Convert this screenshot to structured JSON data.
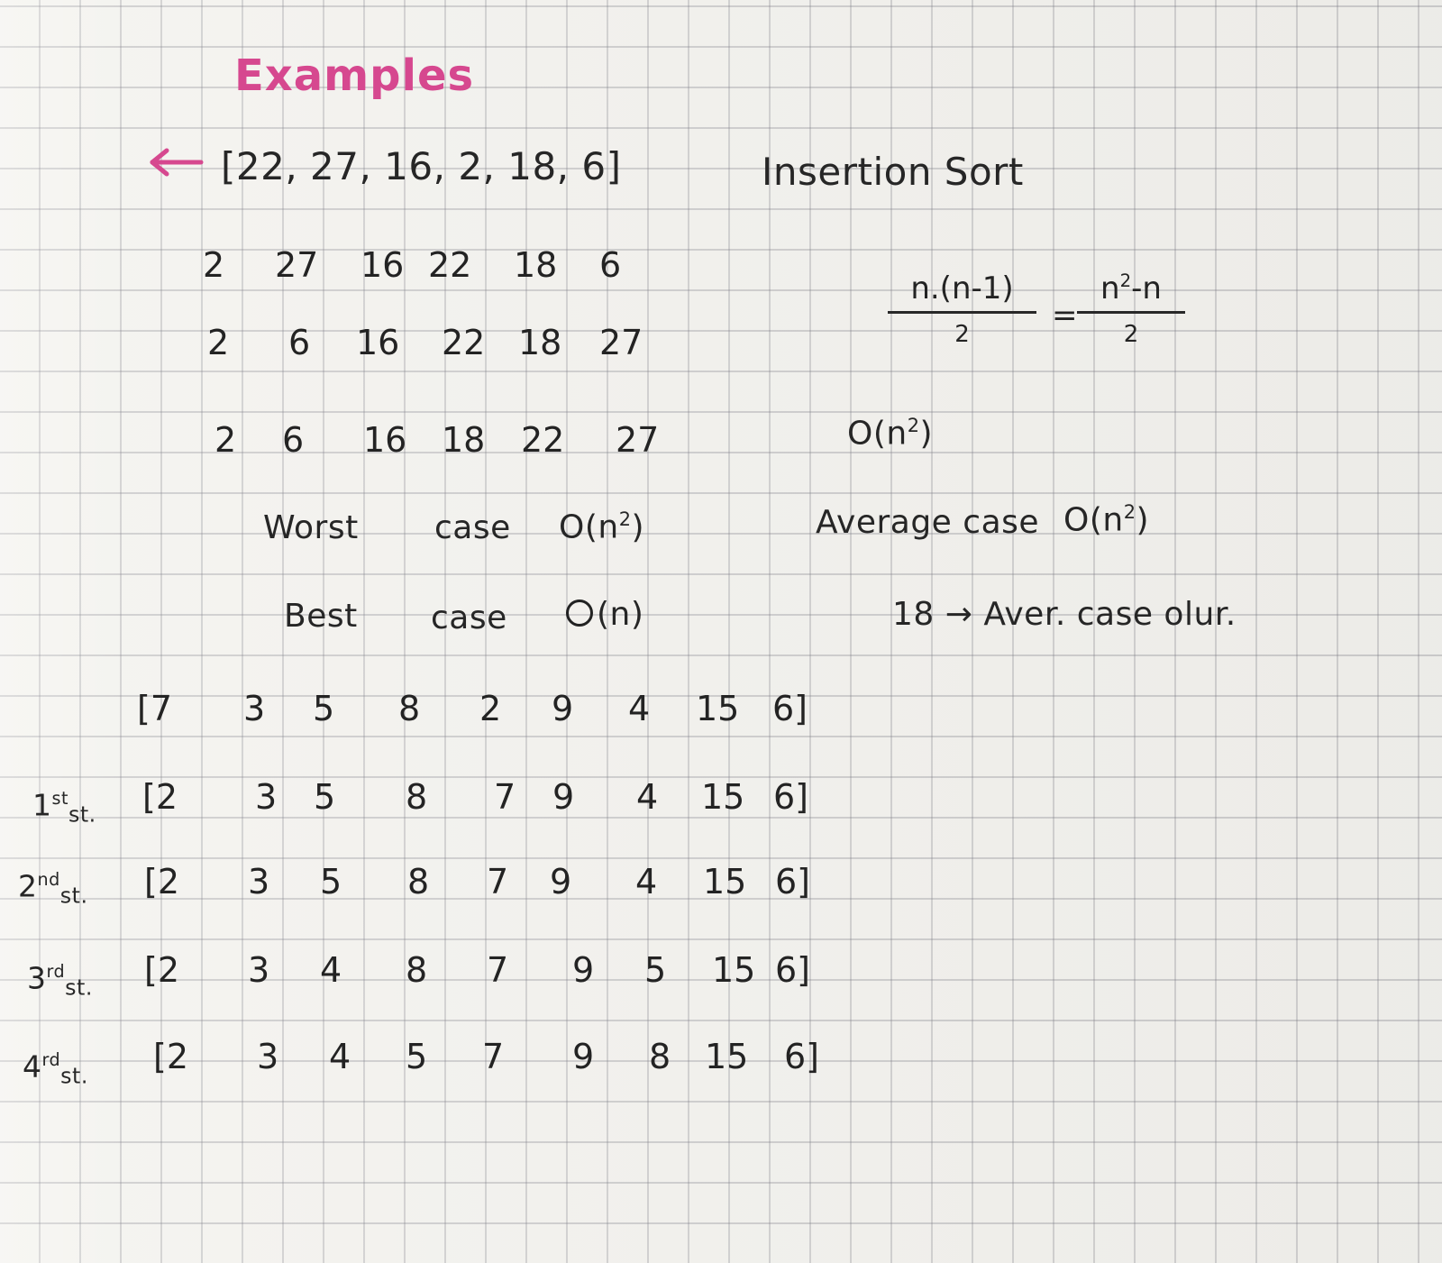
{
  "document": {
    "title": "Examples",
    "section_title": "Insertion Sort",
    "first_example": {
      "input": "[22, 27, 16, 2, 18, 6]",
      "steps": [
        [
          "2",
          "27",
          "16",
          "22",
          "18",
          "6"
        ],
        [
          "2",
          "6",
          "16",
          "22",
          "18",
          "27"
        ],
        [
          "2",
          "6",
          "16",
          "18",
          "22",
          "27"
        ]
      ]
    },
    "formula": {
      "left_numerator": "n.(n-1)",
      "left_denominator": "2",
      "equals": "=",
      "right_numerator_base": "n",
      "right_numerator_exponent": "2",
      "right_numerator_tail": "-n",
      "right_denominator": "2",
      "complexity_base": "O(n",
      "complexity_exponent": "2",
      "complexity_close": ")"
    },
    "cases": {
      "worst_label": "Worst",
      "worst_word": "case",
      "worst_base": "O(n",
      "worst_exponent": "2",
      "worst_close": ")",
      "best_label": "Best",
      "best_word": "case",
      "best_base": "(n)",
      "average_label": "Average case",
      "average_base": "O(n",
      "average_exponent": "2",
      "average_close": ")",
      "average_note": "18 → Aver. case olur."
    },
    "second_example": {
      "initial": [
        "[7",
        "3",
        "5",
        "8",
        "2",
        "9",
        "4",
        "15",
        "6]"
      ],
      "steps": [
        {
          "label_base": "1",
          "label_ordinal": "st",
          "label_tail": "st.",
          "values": [
            "[2",
            "3",
            "5",
            "8",
            "7",
            "9",
            "4",
            "15",
            "6]"
          ]
        },
        {
          "label_base": "2",
          "label_ordinal": "nd",
          "label_tail": "st.",
          "values": [
            "[2",
            "3",
            "5",
            "8",
            "7",
            "9",
            "4",
            "15",
            "6]"
          ]
        },
        {
          "label_base": "3",
          "label_ordinal": "rd",
          "label_tail": "st.",
          "values": [
            "[2",
            "3",
            "4",
            "8",
            "7",
            "9",
            "5",
            "15",
            "6]"
          ]
        },
        {
          "label_base": "4",
          "label_ordinal": "rd",
          "label_tail": "st.",
          "values": [
            "[2",
            "3",
            "4",
            "5",
            "7",
            "9",
            "8",
            "15",
            "6]"
          ]
        }
      ]
    }
  },
  "colors": {
    "ink": "#262626",
    "title_pink": "#d6488f",
    "paper": "#f4f3ef",
    "grid": "#8d8d95"
  },
  "icons": {
    "pointer": "left-arrow-icon"
  }
}
